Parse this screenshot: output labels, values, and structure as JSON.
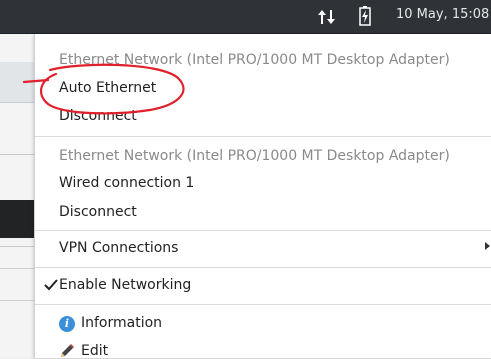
{
  "panel": {
    "clock": "10 May, 15:08",
    "network_icon": "network-transfer-icon",
    "battery_icon": "battery-charging-icon"
  },
  "menu": {
    "section1": {
      "header": "Ethernet Network (Intel PRO/1000 MT Desktop Adapter)",
      "connection": "Auto Ethernet",
      "disconnect": "Disconnect"
    },
    "section2": {
      "header": "Ethernet Network (Intel PRO/1000 MT Desktop Adapter)",
      "connection": "Wired connection 1",
      "disconnect": "Disconnect"
    },
    "vpn": "VPN Connections",
    "enable_networking": "Enable Networking",
    "enable_networking_checked": true,
    "information": "Information",
    "edit": "Edit"
  },
  "colors": {
    "panel_bg": "#2f3338",
    "annotation_red": "#e0202a",
    "info_blue": "#3b8fd8"
  }
}
